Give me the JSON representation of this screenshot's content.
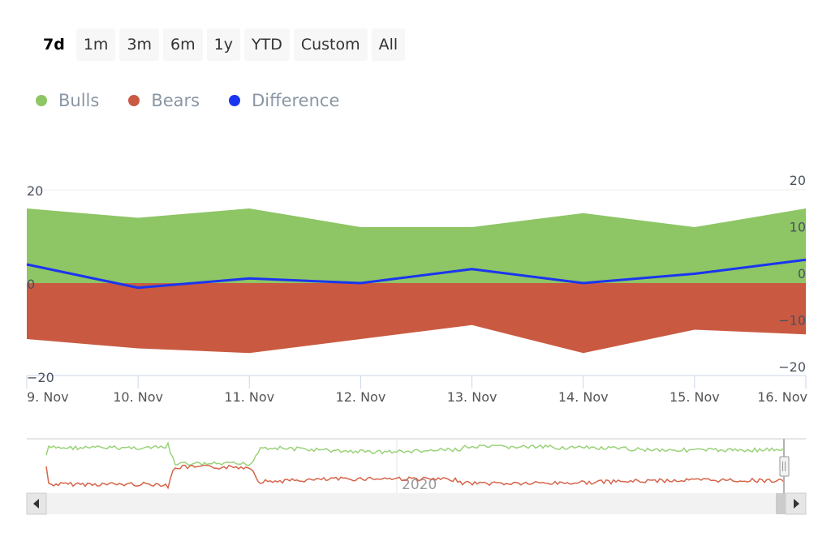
{
  "range_selector": {
    "buttons": [
      {
        "label": "7d",
        "active": true
      },
      {
        "label": "1m",
        "active": false
      },
      {
        "label": "3m",
        "active": false
      },
      {
        "label": "6m",
        "active": false
      },
      {
        "label": "1y",
        "active": false
      },
      {
        "label": "YTD",
        "active": false
      },
      {
        "label": "Custom",
        "active": false
      },
      {
        "label": "All",
        "active": false
      }
    ]
  },
  "colors": {
    "bulls": "#8ec565",
    "bears": "#c95a41",
    "difference": "#1a35f0",
    "nav_bulls": "#9ad27a",
    "nav_bears": "#d6644a"
  },
  "chart_data": {
    "type": "area",
    "title": "",
    "categories": [
      "9. Nov",
      "10. Nov",
      "11. Nov",
      "12. Nov",
      "13. Nov",
      "14. Nov",
      "15. Nov",
      "16. Nov"
    ],
    "series": [
      {
        "name": "Bulls",
        "type": "area",
        "values": [
          16,
          14,
          16,
          12,
          12,
          15,
          12,
          16
        ]
      },
      {
        "name": "Bears",
        "type": "area",
        "values": [
          -12,
          -14,
          -15,
          -12,
          -9,
          -15,
          -10,
          -11
        ]
      },
      {
        "name": "Difference",
        "type": "line",
        "values": [
          4,
          -1,
          1,
          0,
          3,
          0,
          2,
          5
        ]
      }
    ],
    "y_left": {
      "ticks": [
        "20",
        "0",
        "−20"
      ],
      "values": [
        20,
        0,
        -20
      ],
      "range": [
        -20,
        20
      ]
    },
    "y_right": {
      "ticks": [
        "20",
        "10",
        "0",
        "−10",
        "−20"
      ],
      "values": [
        20,
        10,
        0,
        -10,
        -20
      ],
      "range": [
        -20,
        20
      ]
    },
    "legend": [
      "Bulls",
      "Bears",
      "Difference"
    ],
    "legend_position": "top-left",
    "grid": true,
    "navigator": {
      "label": "2020",
      "series": [
        "Bulls",
        "Bears"
      ],
      "range_selected": "end"
    }
  }
}
